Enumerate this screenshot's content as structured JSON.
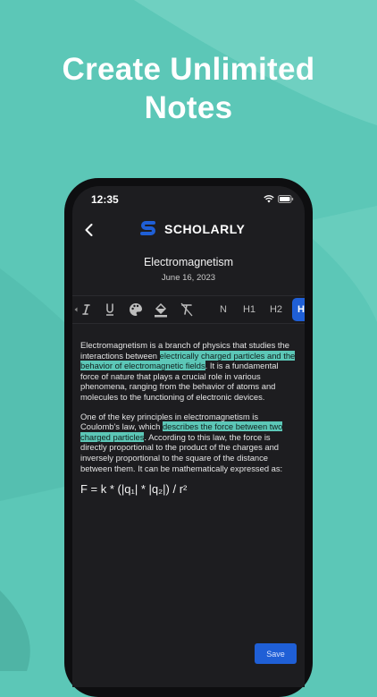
{
  "headline": {
    "line1": "Create Unlimited",
    "line2": "Notes"
  },
  "status": {
    "time": "12:35"
  },
  "brand": {
    "name": "SCHOLARLY"
  },
  "note": {
    "title": "Electromagnetism",
    "date": "June 16, 2023",
    "p1_a": "Electromagnetism is a branch of physics that studies the interactions between ",
    "p1_hl": "electrically charged particles and the behavior of electromagnetic fields",
    "p1_b": ". It is a fundamental force of nature that plays a crucial role in various phenomena, ranging from the behavior of atoms and molecules to the functioning of electronic devices.",
    "p2_a": "One of the key principles in electromagnetism is Coulomb's law, which ",
    "p2_hl": "describes the force between two charged particles",
    "p2_b": ". According to this law, the force is directly proportional to the product of the charges and inversely proportional to the square of the distance between them. It can be mathematically expressed as:",
    "formula": "F = k * (|q₁| * |q₂|) / r²"
  },
  "toolbar": {
    "normal": "N",
    "h1": "H1",
    "h2": "H2",
    "h3_partial": "H"
  },
  "actions": {
    "save": "Save"
  },
  "colors": {
    "background": "#5cc7b7",
    "highlight": "#5cc7b7",
    "accent": "#1f5fd6",
    "screen": "#1d1d20"
  }
}
